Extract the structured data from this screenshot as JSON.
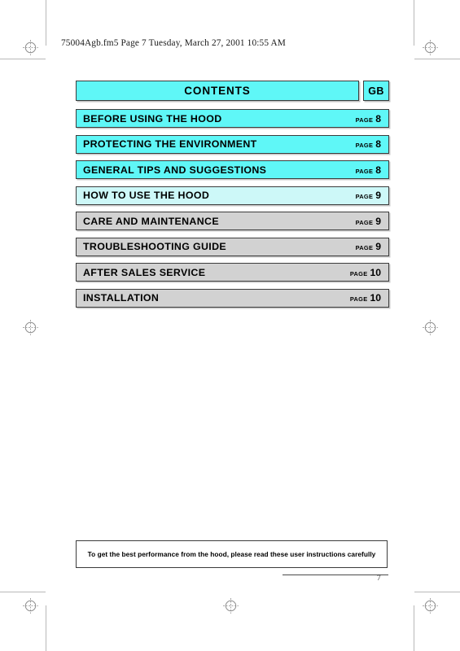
{
  "document": {
    "header_line": "75004Agb.fm5  Page 7  Tuesday, March 27, 2001  10:55 AM",
    "page_number": "7"
  },
  "contents": {
    "title": "CONTENTS",
    "language_code": "GB",
    "page_word": "PAGE",
    "items": [
      {
        "label": "BEFORE USING THE HOOD",
        "page": "8",
        "style": "cyan"
      },
      {
        "label": "PROTECTING THE ENVIRONMENT",
        "page": "8",
        "style": "cyan"
      },
      {
        "label": "GENERAL TIPS AND SUGGESTIONS",
        "page": "8",
        "style": "cyan"
      },
      {
        "label": "HOW TO USE THE HOOD",
        "page": "9",
        "style": "pale"
      },
      {
        "label": "CARE AND MAINTENANCE",
        "page": "9",
        "style": "grey"
      },
      {
        "label": "TROUBLESHOOTING GUIDE",
        "page": "9",
        "style": "grey"
      },
      {
        "label": "AFTER SALES SERVICE",
        "page": "10",
        "style": "grey"
      },
      {
        "label": "INSTALLATION",
        "page": "10",
        "style": "grey"
      }
    ]
  },
  "footer": {
    "note": "To get the best performance from the hood, please read these user instructions carefully"
  },
  "colors": {
    "accent_cyan": "#5ff7f7",
    "pale_cyan": "#cdf8f8",
    "row_grey": "#d2d2d2",
    "border": "#3c3c3c",
    "crop_mark": "#b9b9b9"
  }
}
